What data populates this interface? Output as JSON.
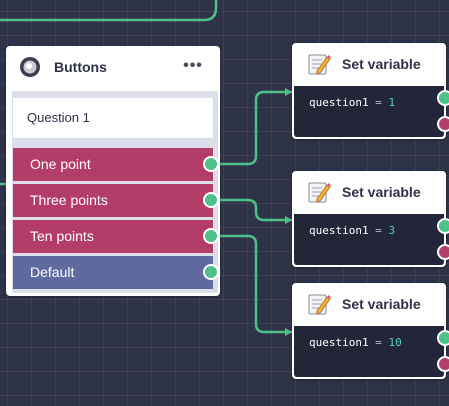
{
  "buttons_node": {
    "title": "Buttons",
    "icon": "toggle-icon",
    "menu_label": "•••",
    "question": "Question 1",
    "options": [
      {
        "label": "One point"
      },
      {
        "label": "Three points"
      },
      {
        "label": "Ten points"
      },
      {
        "label": "Default"
      }
    ]
  },
  "set_variable_nodes": [
    {
      "title": "Set variable",
      "icon": "memo-pencil-icon",
      "variable": "question1",
      "operator": "=",
      "value": "1"
    },
    {
      "title": "Set variable",
      "icon": "memo-pencil-icon",
      "variable": "question1",
      "operator": "=",
      "value": "3"
    },
    {
      "title": "Set variable",
      "icon": "memo-pencil-icon",
      "variable": "question1",
      "operator": "=",
      "value": "10"
    }
  ],
  "colors": {
    "canvas": "#2f3348",
    "option": "#b43c68",
    "default_option": "#5f6a9e",
    "port_success": "#4ec08a",
    "port_failure": "#b43c68",
    "code_background": "#232639",
    "code_number": "#56d4b7"
  }
}
